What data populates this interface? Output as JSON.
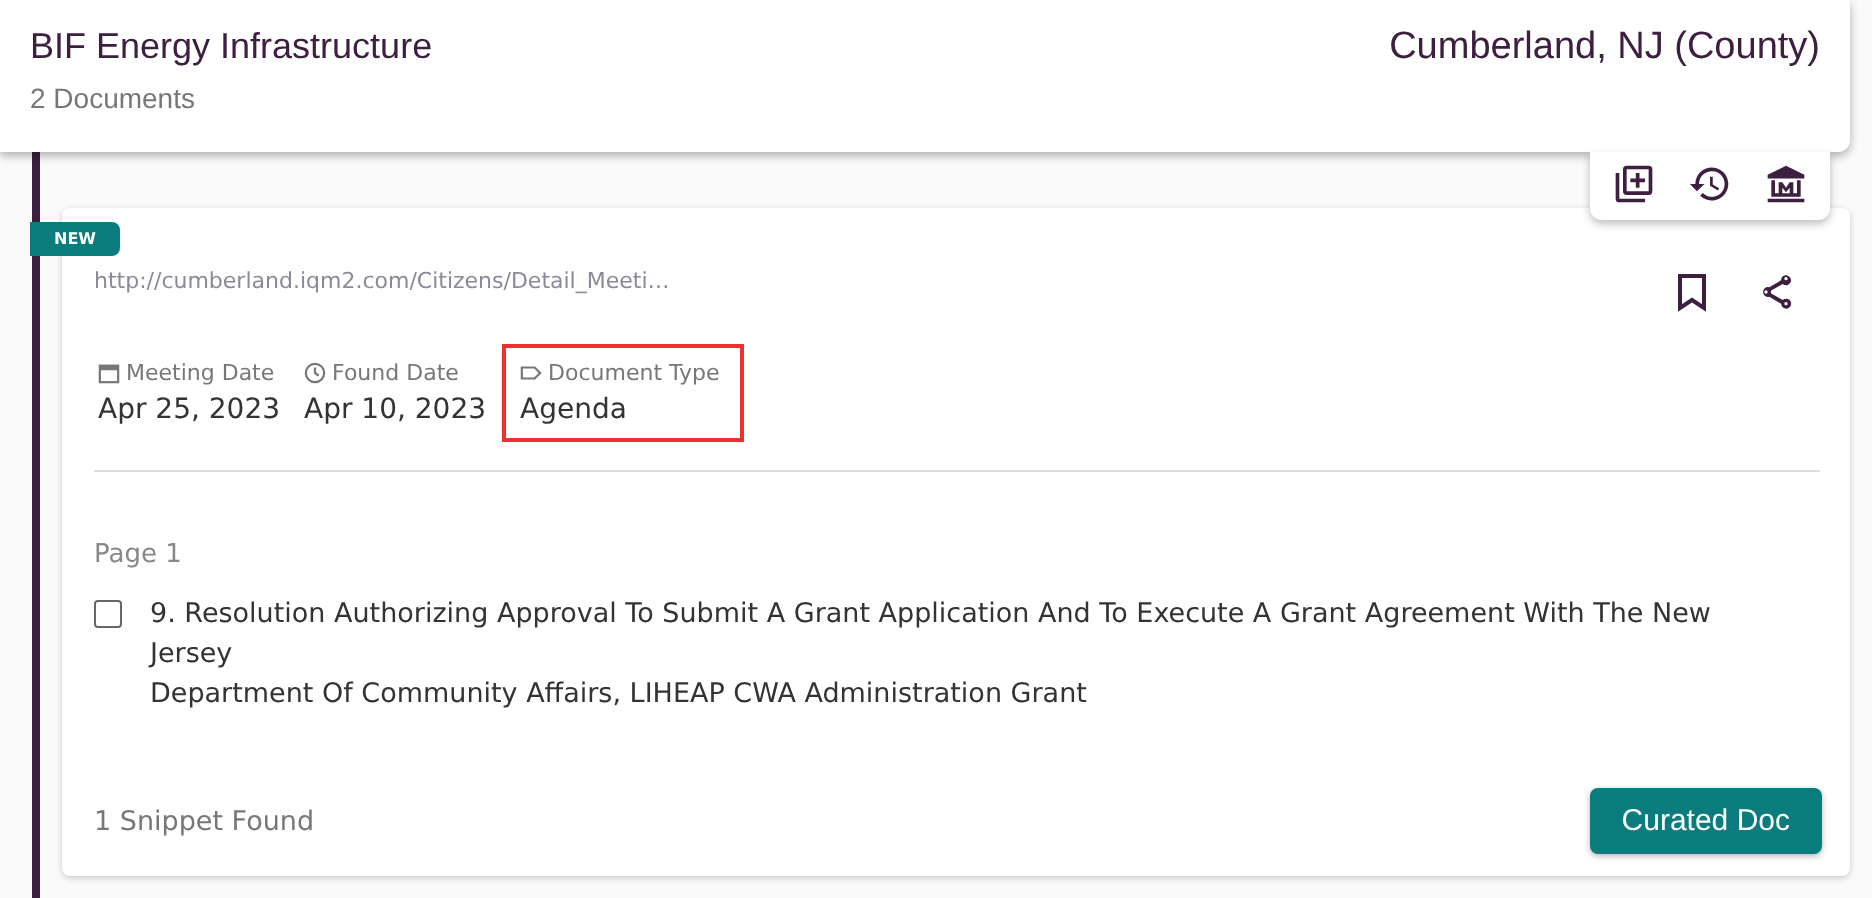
{
  "header": {
    "title": "BIF Energy Infrastructure",
    "subtitle": "2 Documents",
    "location": "Cumberland, NJ (County)"
  },
  "document": {
    "badge": "NEW",
    "url": "http://cumberland.iqm2.com/Citizens/Detail_Meeti…",
    "bookmarked": false,
    "meta": [
      {
        "kind": "calendar",
        "label": "Meeting Date",
        "value": "Apr 25, 2023",
        "highlighted": false
      },
      {
        "kind": "clock",
        "label": "Found Date",
        "value": "Apr 10, 2023",
        "highlighted": false
      },
      {
        "kind": "tag",
        "label": "Document Type",
        "value": "Agenda",
        "highlighted": true
      }
    ],
    "page_label": "Page 1",
    "snippets": [
      {
        "checked": false,
        "lines": [
          "9. Resolution Authorizing Approval To Submit A Grant Application And To Execute A Grant Agreement With The New Jersey",
          "Department Of Community Affairs, LIHEAP CWA Administration Grant"
        ]
      }
    ],
    "footer": "1 Snippet Found",
    "button": "Curated Doc"
  }
}
